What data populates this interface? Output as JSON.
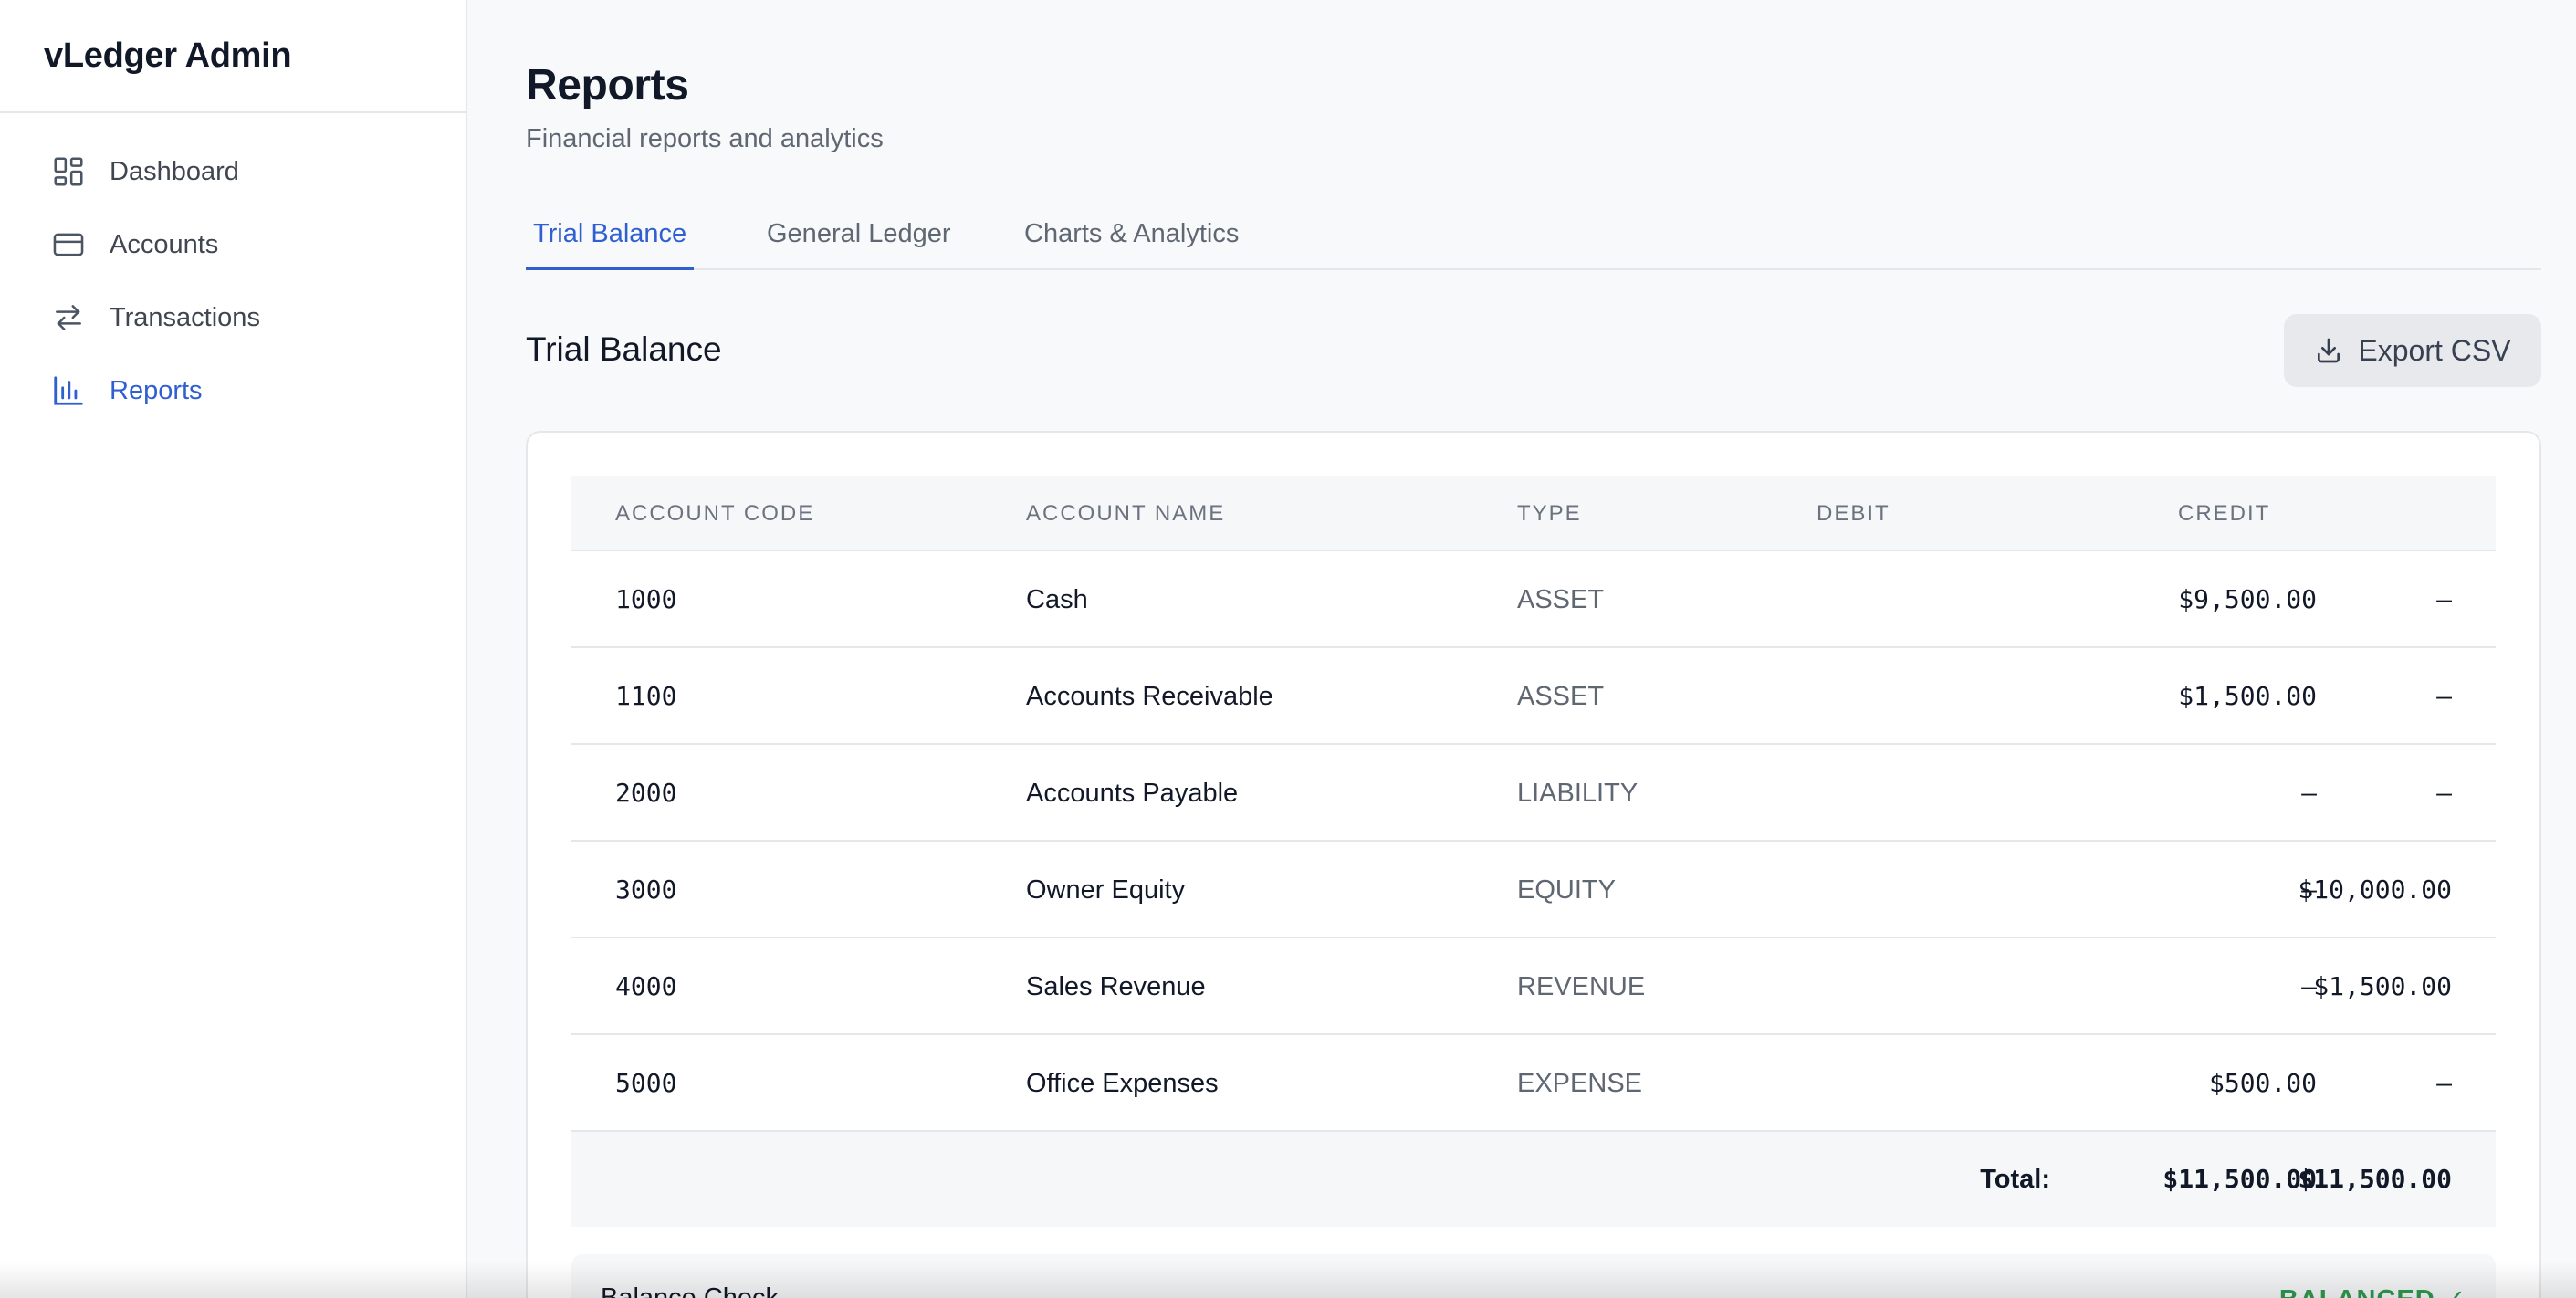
{
  "sidebar": {
    "brand": "vLedger Admin",
    "items": [
      {
        "label": "Dashboard",
        "icon": "dashboard-grid-icon"
      },
      {
        "label": "Accounts",
        "icon": "credit-card-icon"
      },
      {
        "label": "Transactions",
        "icon": "arrows-swap-icon"
      },
      {
        "label": "Reports",
        "icon": "bar-chart-icon",
        "active": true
      }
    ]
  },
  "header": {
    "title": "Reports",
    "subtitle": "Financial reports and analytics"
  },
  "tabs": [
    {
      "label": "Trial Balance",
      "active": true
    },
    {
      "label": "General Ledger"
    },
    {
      "label": "Charts & Analytics"
    }
  ],
  "section": {
    "title": "Trial Balance",
    "export_label": "Export CSV"
  },
  "table": {
    "columns": [
      "ACCOUNT CODE",
      "ACCOUNT NAME",
      "TYPE",
      "DEBIT",
      "CREDIT"
    ],
    "rows": [
      {
        "code": "1000",
        "name": "Cash",
        "type": "ASSET",
        "debit": "$9,500.00",
        "credit": "–"
      },
      {
        "code": "1100",
        "name": "Accounts Receivable",
        "type": "ASSET",
        "debit": "$1,500.00",
        "credit": "–"
      },
      {
        "code": "2000",
        "name": "Accounts Payable",
        "type": "LIABILITY",
        "debit": "–",
        "credit": "–"
      },
      {
        "code": "3000",
        "name": "Owner Equity",
        "type": "EQUITY",
        "debit": "–",
        "credit": "$10,000.00"
      },
      {
        "code": "4000",
        "name": "Sales Revenue",
        "type": "REVENUE",
        "debit": "–",
        "credit": "$1,500.00"
      },
      {
        "code": "5000",
        "name": "Office Expenses",
        "type": "EXPENSE",
        "debit": "$500.00",
        "credit": "–"
      }
    ],
    "total": {
      "label": "Total:",
      "debit": "$11,500.00",
      "credit": "$11,500.00"
    }
  },
  "balance_check": {
    "label": "Balance Check",
    "status": "BALANCED ✓"
  },
  "colors": {
    "accent": "#2f5fd0",
    "balanced": "#2e9a4e"
  }
}
